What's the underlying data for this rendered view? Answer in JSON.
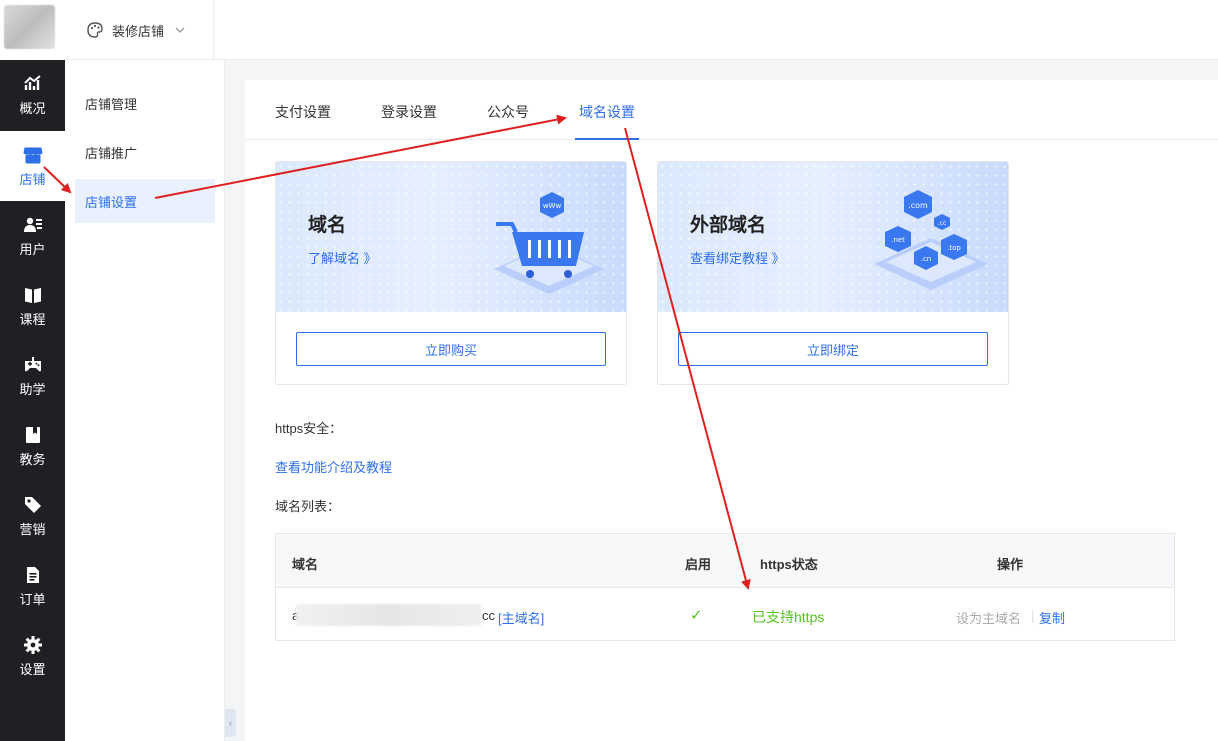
{
  "header": {
    "store_switch_label": "装修店铺"
  },
  "rail": {
    "items": [
      {
        "label": "概况",
        "icon": "chart-trend-icon"
      },
      {
        "label": "店铺",
        "icon": "shop-icon",
        "active": true
      },
      {
        "label": "用户",
        "icon": "users-icon"
      },
      {
        "label": "课程",
        "icon": "book-icon"
      },
      {
        "label": "助学",
        "icon": "gamepad-icon"
      },
      {
        "label": "教务",
        "icon": "bookmark-icon"
      },
      {
        "label": "营销",
        "icon": "tag-icon"
      },
      {
        "label": "订单",
        "icon": "document-icon"
      },
      {
        "label": "设置",
        "icon": "gear-icon"
      }
    ]
  },
  "sub_sidebar": {
    "items": [
      {
        "label": "店铺管理"
      },
      {
        "label": "店铺推广"
      },
      {
        "label": "店铺设置",
        "active": true
      }
    ]
  },
  "tabs": [
    {
      "label": "支付设置"
    },
    {
      "label": "登录设置"
    },
    {
      "label": "公众号"
    },
    {
      "label": "域名设置",
      "active": true
    }
  ],
  "cards": [
    {
      "title": "域名",
      "link": "了解域名 》",
      "button": "立即购买",
      "art": "cart-www-icon"
    },
    {
      "title": "外部域名",
      "link": "查看绑定教程 》",
      "button": "立即绑定",
      "art": "tld-cubes-icon"
    }
  ],
  "art_labels": {
    "www": "wWw",
    "com": ".com",
    "cc": ".cc",
    "net": ".net",
    "top": ".top",
    "cn": ".cn"
  },
  "https_section": {
    "label": "https安全：",
    "link": "查看功能介绍及教程"
  },
  "domain_list": {
    "label": "域名列表：",
    "columns": [
      "域名",
      "启用",
      "https状态",
      "操作"
    ],
    "rows": [
      {
        "domain_prefix": "a",
        "domain_suffix": "cc",
        "primary_tag": "[主域名]",
        "enabled_mark": "✓",
        "https_status": "已支持https",
        "action_disabled": "设为主域名",
        "action_copy": "复制"
      }
    ]
  },
  "colors": {
    "accent": "#2e6fe6",
    "success": "#52c41a",
    "annotation": "#e02020",
    "rail_bg": "#1f2024"
  }
}
